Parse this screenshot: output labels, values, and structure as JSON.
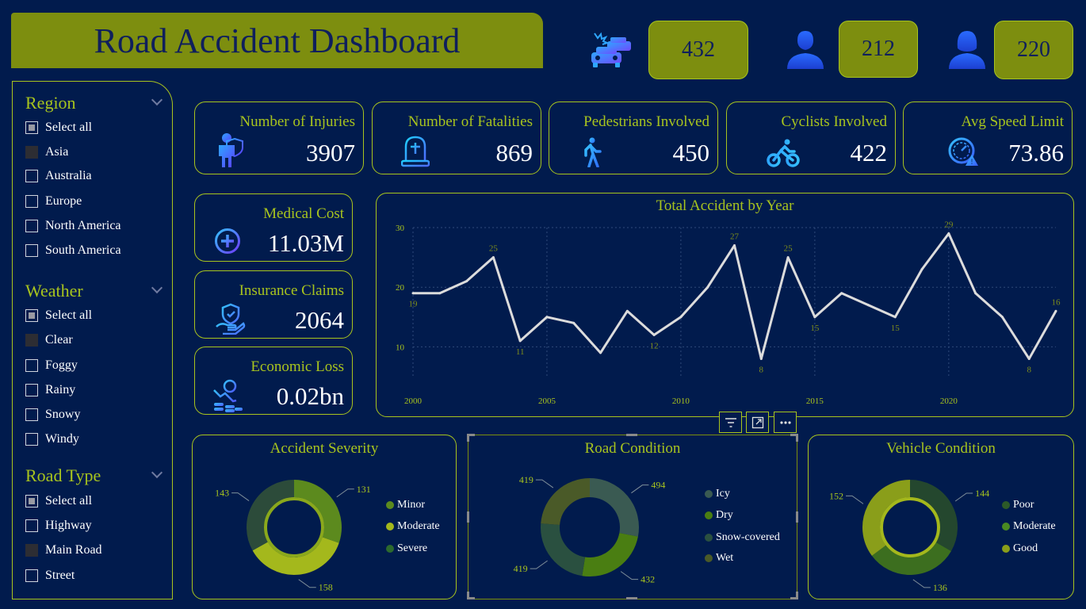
{
  "header": {
    "title": "Road Accident Dashboard",
    "total_vehicles": "432",
    "male": "212",
    "female": "220"
  },
  "slicers": {
    "region": {
      "title": "Region",
      "items": [
        "Select all",
        "Asia",
        "Australia",
        "Europe",
        "North America",
        "South America"
      ]
    },
    "weather": {
      "title": "Weather",
      "items": [
        "Select all",
        "Clear",
        "Foggy",
        "Rainy",
        "Snowy",
        "Windy"
      ]
    },
    "road_type": {
      "title": "Road Type",
      "items": [
        "Select all",
        "Highway",
        "Main Road",
        "Street"
      ]
    }
  },
  "kpis": {
    "injuries": {
      "label": "Number of Injuries",
      "value": "3907",
      "icon": "injured-person-icon"
    },
    "fatalities": {
      "label": "Number of Fatalities",
      "value": "869",
      "icon": "gravestone-icon"
    },
    "pedestrians": {
      "label": "Pedestrians Involved",
      "value": "450",
      "icon": "walking-person-icon"
    },
    "cyclists": {
      "label": "Cyclists Involved",
      "value": "422",
      "icon": "bicycle-icon"
    },
    "speed": {
      "label": "Avg Speed Limit",
      "value": "73.86",
      "icon": "speedometer-icon"
    },
    "medical": {
      "label": "Medical Cost",
      "value": "11.03M",
      "icon": "plus-circle-icon"
    },
    "insurance": {
      "label": "Insurance Claims",
      "value": "2064",
      "icon": "insurance-hand-icon"
    },
    "economic": {
      "label": "Economic Loss",
      "value": "0.02bn",
      "icon": "coins-icon"
    }
  },
  "colors": {
    "background": "#011b4d",
    "accent": "#a8c41e",
    "title_bar": "#7d8e0f",
    "line": "#dcdcdc"
  },
  "chart_data": [
    {
      "type": "line",
      "title": "Total Accident by Year",
      "x": [
        2000,
        2001,
        2002,
        2003,
        2004,
        2005,
        2006,
        2007,
        2008,
        2009,
        2010,
        2011,
        2012,
        2013,
        2014,
        2015,
        2016,
        2017,
        2018,
        2019,
        2020,
        2021,
        2022,
        2023,
        2024
      ],
      "y": [
        19,
        19,
        21,
        25,
        11,
        15,
        14,
        9,
        16,
        12,
        15,
        20,
        27,
        8,
        25,
        15,
        19,
        17,
        15,
        23,
        29,
        19,
        15,
        8,
        16
      ],
      "data_labels": {
        "0": "19",
        "3": "25",
        "4": "11",
        "9": "12",
        "12": "27",
        "13": "8",
        "14": "25",
        "15": "15",
        "18": "15",
        "20": "29",
        "23": "8",
        "24": "16"
      },
      "x_ticks": [
        2000,
        2005,
        2010,
        2015,
        2020
      ],
      "y_ticks": [
        10,
        20,
        30
      ],
      "xlim": [
        2000,
        2024
      ],
      "ylim": [
        5,
        30
      ],
      "grid": true
    },
    {
      "type": "pie",
      "title": "Accident Severity",
      "labels": [
        "Minor",
        "Moderate",
        "Severe"
      ],
      "values": [
        131,
        158,
        143
      ],
      "colors": [
        "#5c8a1e",
        "#a4b81c",
        "#2c4b3a"
      ]
    },
    {
      "type": "pie",
      "title": "Road Condition",
      "labels": [
        "Icy",
        "Dry",
        "Snow-covered",
        "Wet"
      ],
      "values": [
        494,
        432,
        419,
        419
      ],
      "colors": [
        "#3a5a52",
        "#4a7e12",
        "#2a5040",
        "#4a5a28"
      ]
    },
    {
      "type": "pie",
      "title": "Vehicle Condition",
      "labels": [
        "Poor",
        "Moderate",
        "Good"
      ],
      "values": [
        144,
        136,
        152
      ],
      "colors": [
        "#24472e",
        "#3c6e1f",
        "#8a9e1a"
      ]
    }
  ]
}
